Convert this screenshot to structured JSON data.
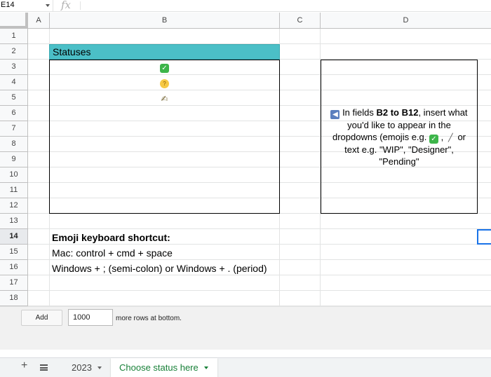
{
  "formula_bar": {
    "name_box": "E14",
    "fx_label": "fx"
  },
  "columns": [
    "A",
    "B",
    "C",
    "D"
  ],
  "rows": [
    "1",
    "2",
    "3",
    "4",
    "5",
    "6",
    "7",
    "8",
    "9",
    "10",
    "11",
    "12",
    "13",
    "14",
    "15",
    "16",
    "17",
    "18"
  ],
  "active_row": "14",
  "statuses": {
    "header": "Statuses",
    "items": [
      {
        "icon": "check-mark-emoji",
        "glyph": "✓"
      },
      {
        "icon": "thinking-face-emoji",
        "glyph": "?"
      },
      {
        "icon": "writing-hand-emoji",
        "glyph": "✍"
      }
    ]
  },
  "instructions": {
    "pre": " In fields ",
    "range": "B2 to B12",
    "mid1": ", insert what you'd like to appear in the dropdowns (emojis e.g. ",
    "sep": " , ",
    "mid2": " or text e.g. \"WIP\", \"Designer\", \"Pending\""
  },
  "shortcuts": {
    "title": "Emoji keyboard shortcut:",
    "mac": "Mac: control + cmd + space",
    "windows": "Windows + ; (semi-colon) or Windows + . (period)"
  },
  "add_rows": {
    "button": "Add",
    "count": "1000",
    "label": "more rows at bottom."
  },
  "sheet_tabs": [
    {
      "name": "2023",
      "active": false
    },
    {
      "name": "Choose status here",
      "active": true
    }
  ],
  "colors": {
    "status_header": "#4bbfc7",
    "active_tab": "#188038",
    "selection": "#1a73e8"
  }
}
